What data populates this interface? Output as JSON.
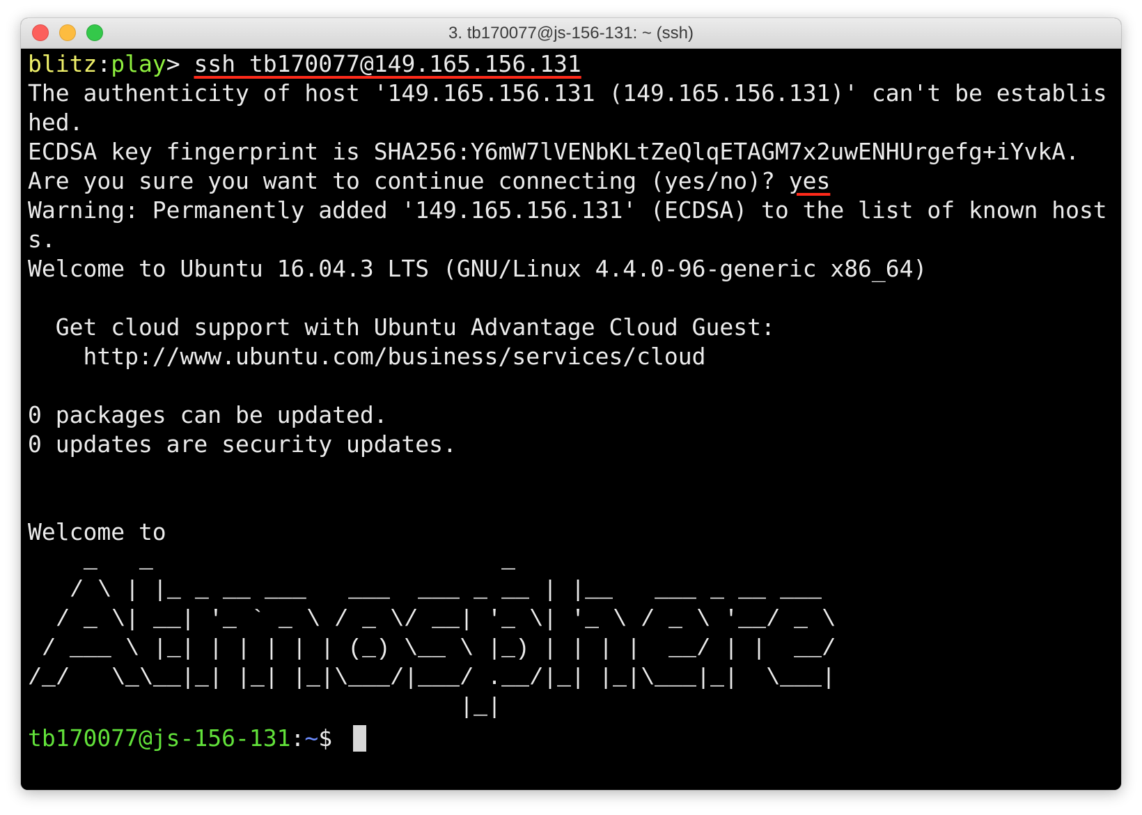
{
  "window": {
    "title": "3. tb170077@js-156-131: ~ (ssh)"
  },
  "terminal": {
    "prompt_host": "blitz",
    "prompt_sep": ":",
    "prompt_dir": "play",
    "prompt_end": "> ",
    "ssh_command": "ssh tb170077@149.165.156.131",
    "line_auth_1": "The authenticity of host '149.165.156.131 (149.165.156.131)' can't be establis",
    "line_auth_2": "hed.",
    "line_fingerprint": "ECDSA key fingerprint is SHA256:Y6mW7lVENbKLtZeQlqETAGM7x2uwENHUrgefg+iYvkA.",
    "line_continue": "Are you sure you want to continue connecting (yes/no)? ",
    "answer": "yes",
    "line_warning_1": "Warning: Permanently added '149.165.156.131' (ECDSA) to the list of known host",
    "line_warning_2": "s.",
    "line_welcome_ubuntu": "Welcome to Ubuntu 16.04.3 LTS (GNU/Linux 4.4.0-96-generic x86_64)",
    "line_cloud_support": "  Get cloud support with Ubuntu Advantage Cloud Guest:",
    "line_cloud_url": "    http://www.ubuntu.com/business/services/cloud",
    "line_packages": "0 packages can be updated.",
    "line_security": "0 updates are security updates.",
    "line_welcome_to": "Welcome to",
    "ascii_art": [
      "    _   _                         _",
      "   / \\ | |_ _ __ ___   ___  ___ _ __ | |__   ___ _ __ ___",
      "  / _ \\| __| '_ ` _ \\ / _ \\/ __| '_ \\| '_ \\ / _ \\ '__/ _ \\",
      " / ___ \\ |_| | | | | | (_) \\__ \\ |_) | | | |  __/ | |  __/",
      "/_/   \\_\\__|_| |_| |_|\\___/|___/ .__/|_| |_|\\___|_|  \\___|",
      "                               |_|"
    ],
    "final_prompt_user": "tb170077@js-156-131",
    "final_prompt_sep": ":",
    "final_prompt_dir": "~",
    "final_prompt_end": "$ "
  }
}
